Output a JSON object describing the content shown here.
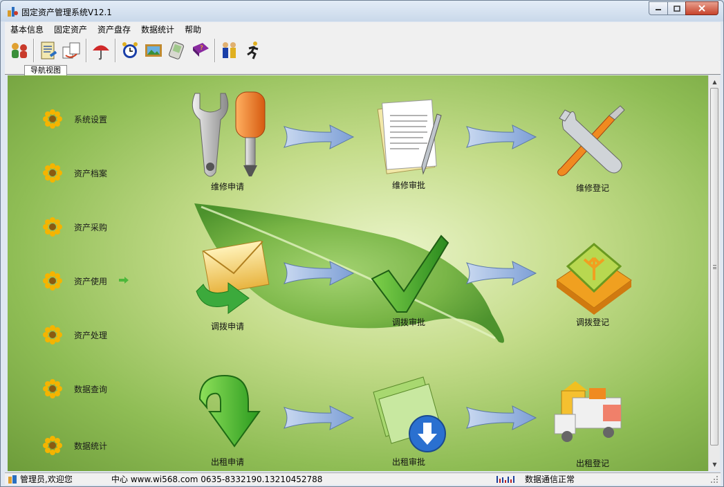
{
  "window": {
    "title": "固定资产管理系统V12.1"
  },
  "menu": {
    "items": [
      "基本信息",
      "固定资产",
      "资产盘存",
      "数据统计",
      "帮助"
    ]
  },
  "toolbar": {
    "buttons": [
      "users-icon",
      "document-edit-icon",
      "transfer-icon",
      "umbrella-icon",
      "alarm-clock-icon",
      "picture-icon",
      "handheld-icon",
      "help-book-icon",
      "people-icon",
      "run-icon"
    ]
  },
  "tab": {
    "label": "导航视图"
  },
  "nav": {
    "items": [
      {
        "label": "系统设置"
      },
      {
        "label": "资产档案"
      },
      {
        "label": "资产采购"
      },
      {
        "label": "资产使用"
      },
      {
        "label": "资产处理"
      },
      {
        "label": "数据查询"
      },
      {
        "label": "数据统计"
      }
    ]
  },
  "flow": {
    "row1": [
      "维修申请",
      "维修审批",
      "维修登记"
    ],
    "row2": [
      "调拨申请",
      "调拨审批",
      "调拨登记"
    ],
    "row3": [
      "出租申请",
      "出租审批",
      "出租登记"
    ]
  },
  "status": {
    "user": "管理员,欢迎您",
    "contact": "中心 www.wi568.com 0635-8332190.13210452788",
    "comm": "数据通信正常"
  },
  "colors": {
    "accent_green": "#5a9e2f",
    "flower_yellow": "#f5b400",
    "arrow_blue": "#8fb0de"
  }
}
